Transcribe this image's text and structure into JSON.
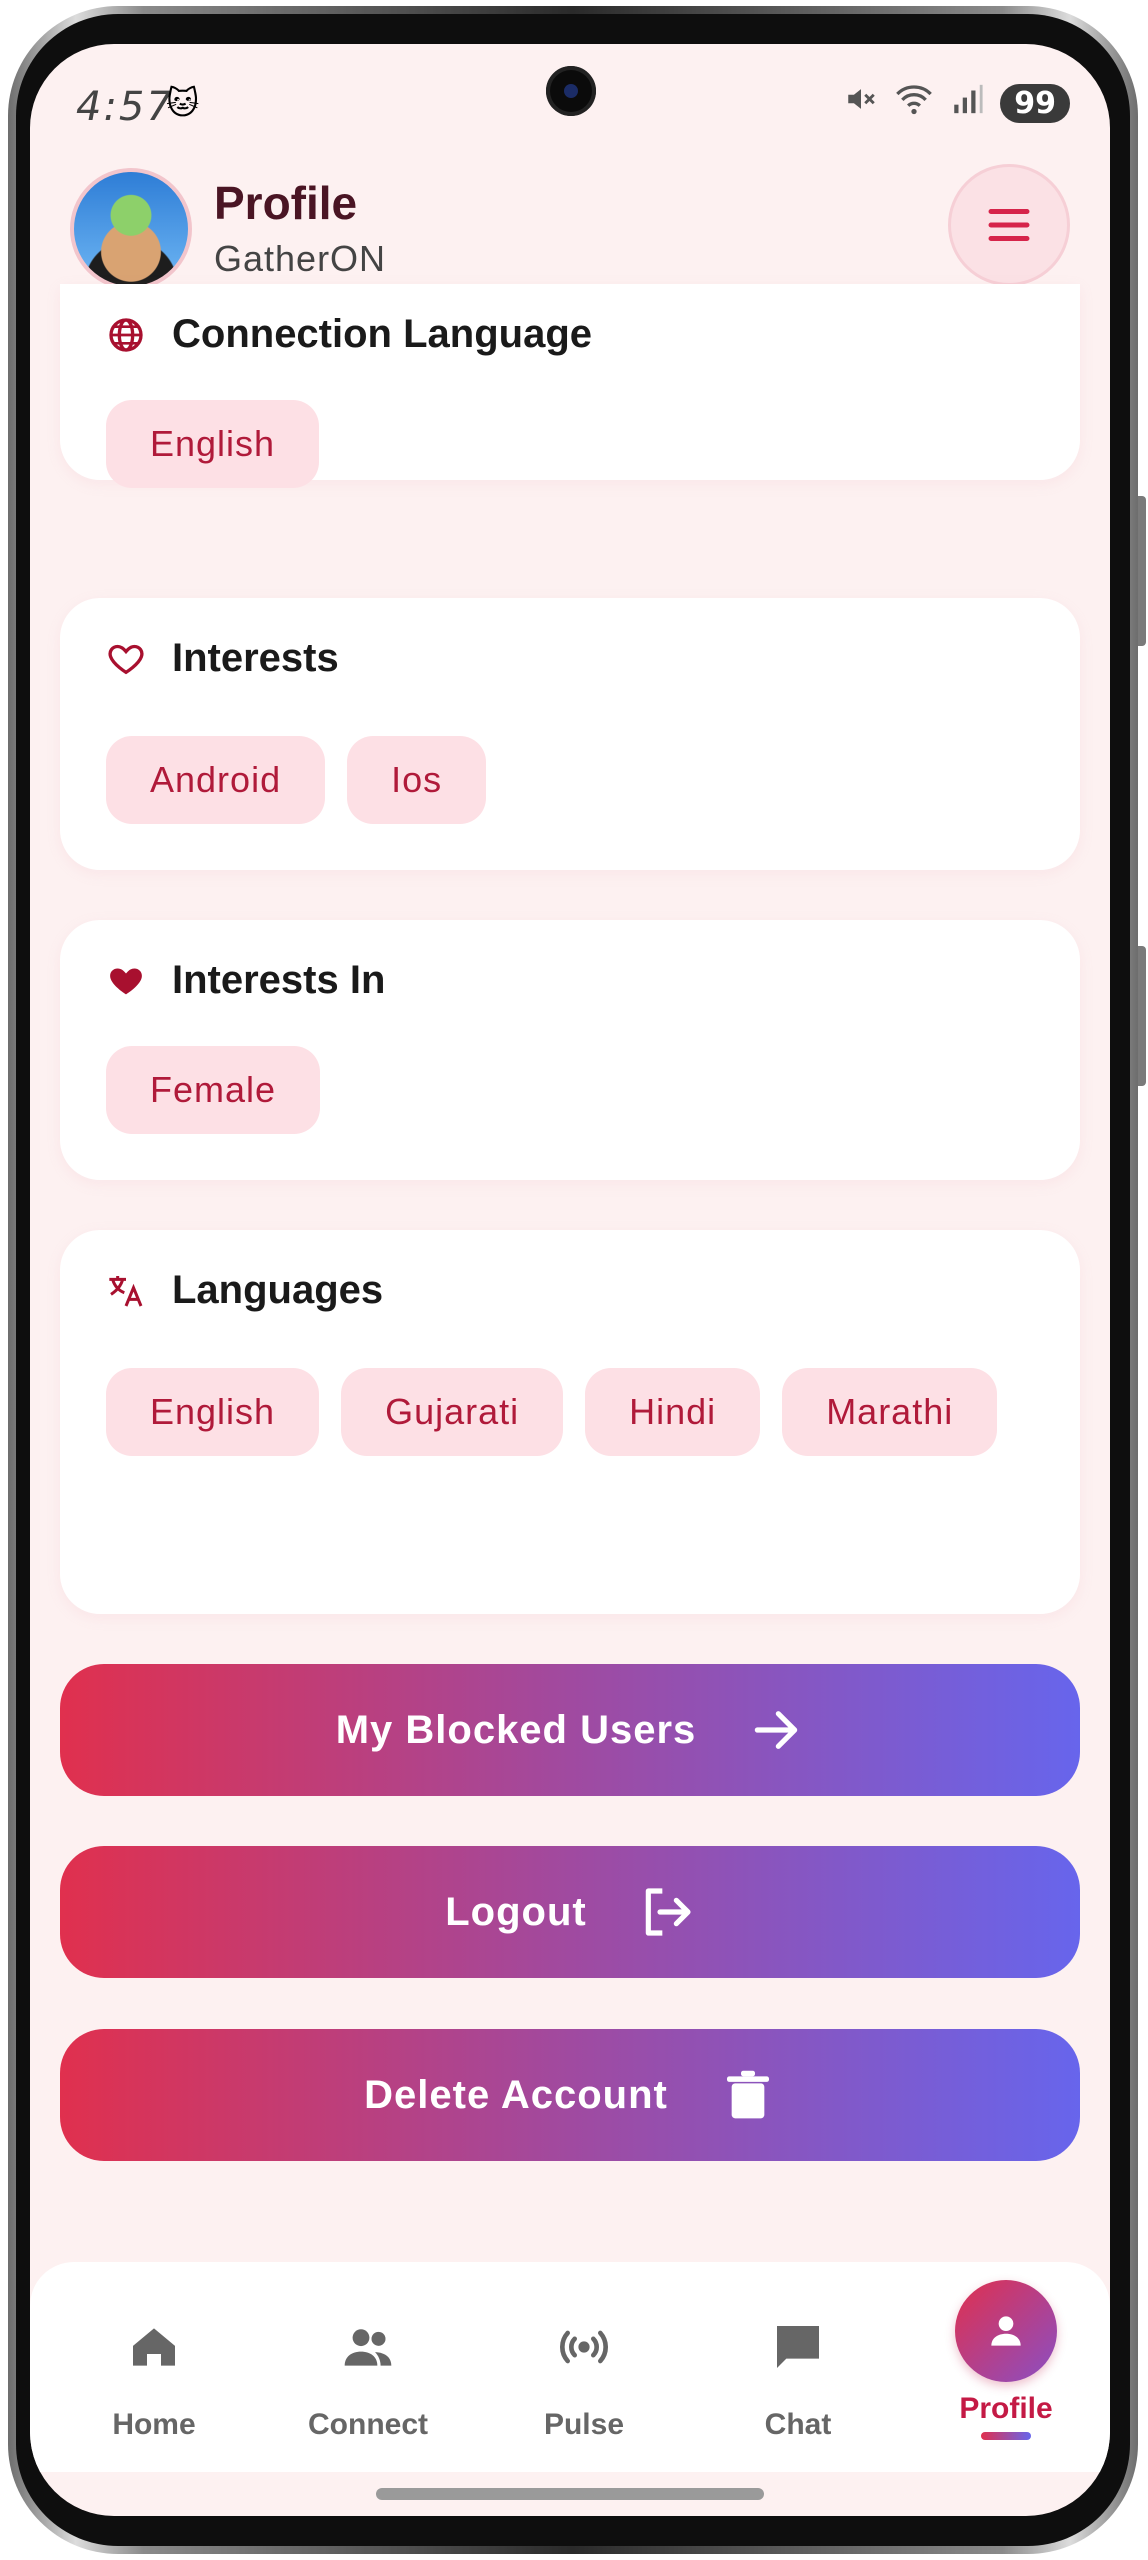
{
  "status_bar": {
    "time": "4:57",
    "battery": "99"
  },
  "header": {
    "title": "Profile",
    "subtitle": "GatherON"
  },
  "cards": {
    "connection_language": {
      "title": "Connection Language",
      "chips": [
        "English"
      ]
    },
    "interests": {
      "title": "Interests",
      "chips": [
        "Android",
        "Ios"
      ]
    },
    "interests_in": {
      "title": "Interests In",
      "chips": [
        "Female"
      ]
    },
    "languages": {
      "title": "Languages",
      "chips": [
        "English",
        "Gujarati",
        "Hindi",
        "Marathi"
      ]
    }
  },
  "buttons": {
    "blocked_users": "My Blocked Users",
    "logout": "Logout",
    "delete_account": "Delete Account"
  },
  "bottom_nav": {
    "items": [
      {
        "label": "Home",
        "icon": "home-icon"
      },
      {
        "label": "Connect",
        "icon": "people-icon"
      },
      {
        "label": "Pulse",
        "icon": "pulse-icon"
      },
      {
        "label": "Chat",
        "icon": "chat-icon"
      },
      {
        "label": "Profile",
        "icon": "person-icon"
      }
    ],
    "active": "Profile"
  },
  "colors": {
    "accent": "#c41a45",
    "chip_bg": "#fde0e5",
    "gradient_start": "#e0304e",
    "gradient_end": "#6765ec",
    "screen_bg": "#fdf1f1"
  }
}
